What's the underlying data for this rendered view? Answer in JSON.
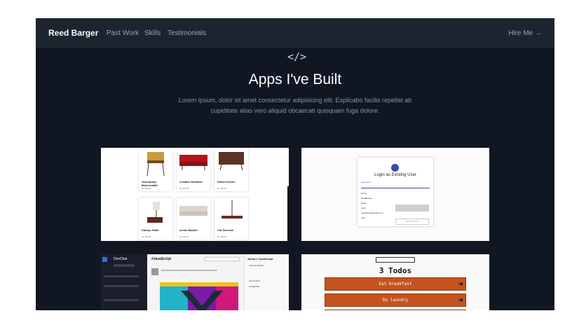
{
  "header": {
    "brand": "Reed Barger",
    "nav": [
      "Past Work",
      "Skills",
      "Testimonials"
    ],
    "cta": "Hire Me →"
  },
  "hero": {
    "icon": "</>",
    "title": "Apps I've Built",
    "description": "Lorem ipsum, dolor sit amet consectetur adipisicing elit. Explicabo facilis repellat ab cupiditate alias vero aliquid obcaecati quisquam fuga dolore."
  },
  "cards": {
    "shop": {
      "products": [
        {
          "name": "Gwendolyn Bickerstaffe",
          "price": "$1,499.99"
        },
        {
          "name": "Cristian Gilbanks",
          "price": "$1,499.99"
        },
        {
          "name": "Kailla Greene",
          "price": "$1,499.99"
        },
        {
          "name": "Kathyn Haith",
          "price": "$1,499.99"
        },
        {
          "name": "Armin Basilio",
          "price": "$1,499.99"
        },
        {
          "name": "Cal Sterman",
          "price": "$1,499.99"
        }
      ]
    },
    "login": {
      "title": "Login as Existing User",
      "username_label": "Username *",
      "fields": [
        "Name",
        "ReedBarger",
        "Reed",
        "reed",
        "reedbarger@email.com",
        "reed"
      ],
      "button": "ENTER NOW"
    },
    "chat": {
      "app_name": "DevChat",
      "channel": "#JavaScript",
      "about": "About # JavaScript",
      "channel_details": "Channel Details",
      "top_posters": "Top Posters",
      "created_by": "Created By"
    },
    "todos": {
      "title": "3 Todos",
      "items": [
        "Eat breakfast",
        "Do laundry"
      ]
    }
  },
  "colors": {
    "background": "#101722",
    "topbar": "#1c2430",
    "accent_todo": "#c5531f"
  }
}
